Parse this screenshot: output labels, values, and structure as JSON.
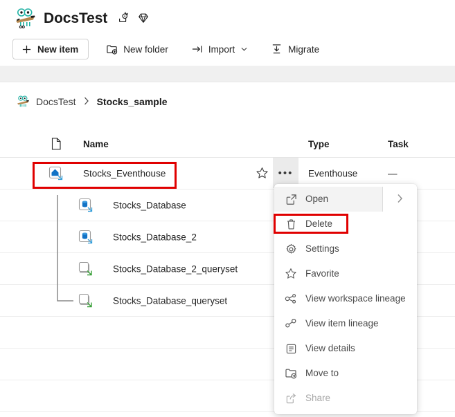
{
  "header": {
    "workspace_title": "DocsTest",
    "workspace_avatar_icon": "workspace-avatar-icon",
    "sparkle_icon": "sparkle-icon",
    "diamond_icon": "diamond-premium-icon"
  },
  "toolbar": {
    "new_item_label": "New item",
    "new_item_icon": "plus-icon",
    "new_folder_label": "New folder",
    "new_folder_icon": "new-folder-icon",
    "import_label": "Import",
    "import_icon": "import-arrow-icon",
    "import_caret": "⌄",
    "migrate_label": "Migrate",
    "migrate_icon": "migrate-download-icon"
  },
  "breadcrumb": {
    "avatar_icon": "workspace-avatar-icon",
    "root": "DocsTest",
    "separator": "›",
    "current": "Stocks_sample"
  },
  "table": {
    "columns": {
      "doc_icon": "document-icon",
      "name": "Name",
      "type": "Type",
      "task": "Task"
    },
    "rows": [
      {
        "name": "Stocks_Eventhouse",
        "type": "Eventhouse",
        "task": "—",
        "icon": "eventhouse-icon",
        "level": 0,
        "star_icon": "favorite-star-icon",
        "more_icon": "more-options-icon",
        "more_label": "•••"
      },
      {
        "name": "Stocks_Database",
        "type": "",
        "task": "",
        "icon": "kql-database-icon",
        "level": 1
      },
      {
        "name": "Stocks_Database_2",
        "type": "",
        "task": "",
        "icon": "kql-database-icon",
        "level": 1
      },
      {
        "name": "Stocks_Database_2_queryset",
        "type": "",
        "task": "",
        "icon": "kql-queryset-icon",
        "level": 1
      },
      {
        "name": "Stocks_Database_queryset",
        "type": "",
        "task": "",
        "icon": "kql-queryset-icon",
        "level": 1
      }
    ]
  },
  "context_menu": {
    "items": [
      {
        "label": "Open",
        "icon": "open-external-icon",
        "state": "highlight",
        "has_submenu": true,
        "chevron": "›"
      },
      {
        "label": "Delete",
        "icon": "trash-delete-icon",
        "state": "normal",
        "has_submenu": false
      },
      {
        "label": "Settings",
        "icon": "gear-settings-icon",
        "state": "normal",
        "has_submenu": false
      },
      {
        "label": "Favorite",
        "icon": "favorite-star-icon",
        "state": "normal",
        "has_submenu": false
      },
      {
        "label": "View workspace lineage",
        "icon": "workspace-lineage-icon",
        "state": "normal",
        "has_submenu": false
      },
      {
        "label": "View item lineage",
        "icon": "item-lineage-icon",
        "state": "normal",
        "has_submenu": false
      },
      {
        "label": "View details",
        "icon": "details-list-icon",
        "state": "normal",
        "has_submenu": false
      },
      {
        "label": "Move to",
        "icon": "move-to-folder-icon",
        "state": "normal",
        "has_submenu": false
      },
      {
        "label": "Share",
        "icon": "share-icon",
        "state": "disabled",
        "has_submenu": false
      }
    ]
  },
  "annotations": {
    "highlight_color": "#e00000",
    "boxes": [
      {
        "target": "Stocks_Eventhouse row name cell"
      },
      {
        "target": "Delete menu item"
      }
    ]
  }
}
